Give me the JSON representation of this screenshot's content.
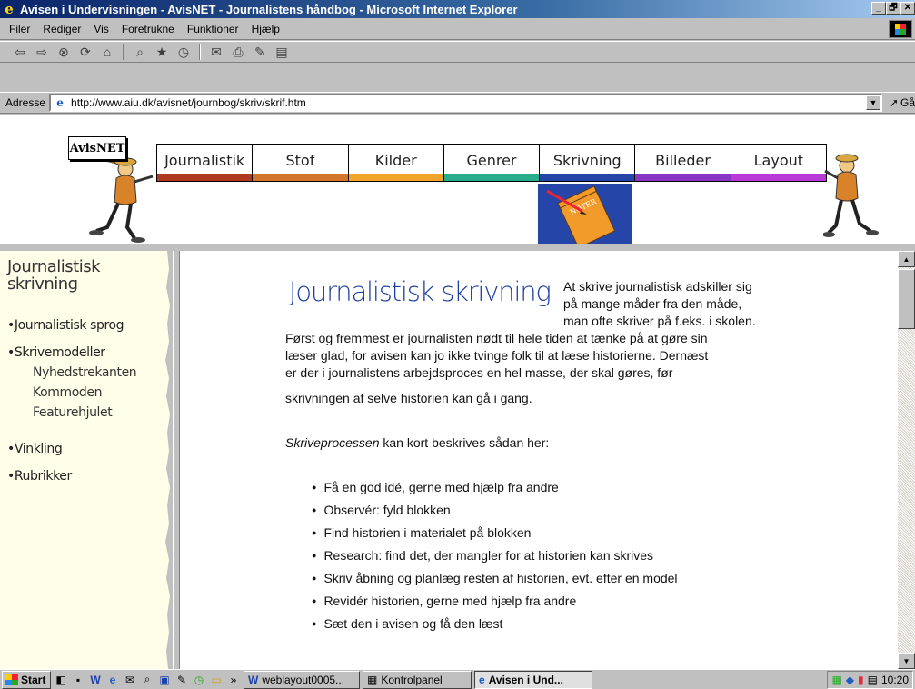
{
  "window": {
    "title": "Avisen i Undervisningen - AvisNET - Journalistens håndbog - Microsoft Internet Explorer",
    "controls": [
      "_",
      "🗗",
      "✕"
    ]
  },
  "menubar": {
    "items": [
      "Filer",
      "Rediger",
      "Vis",
      "Foretrukne",
      "Funktioner",
      "Hjælp"
    ]
  },
  "toolbar": {
    "icons": [
      "back-icon",
      "forward-icon",
      "stop-icon",
      "refresh-icon",
      "home-icon",
      "search-icon",
      "favorites-icon",
      "history-icon",
      "mail-icon",
      "print-icon",
      "edit-icon",
      "discuss-icon"
    ]
  },
  "address": {
    "label": "Adresse",
    "url": "http://www.aiu.dk/avisnet/journbog/skriv/skrif.htm",
    "go_label": "Gå"
  },
  "banner": {
    "sign": "AvisNET",
    "tabs": [
      {
        "label": "Journalistik",
        "color": "#b03a1f"
      },
      {
        "label": "Stof",
        "color": "#d2762a"
      },
      {
        "label": "Kilder",
        "color": "#f2a42b"
      },
      {
        "label": "Genrer",
        "color": "#27ad8c"
      },
      {
        "label": "Skrivning",
        "color": "#2546a8"
      },
      {
        "label": "Billeder",
        "color": "#8a36c4"
      },
      {
        "label": "Layout",
        "color": "#b83ad6"
      }
    ],
    "notebook_label": "NOTER"
  },
  "sidebar": {
    "title_line1": "Journalistisk",
    "title_line2": "skrivning",
    "items": [
      "•Journalistisk sprog",
      "•Skrivemodeller",
      "Nyhedstrekanten",
      "Kommoden",
      "Featurehjulet",
      "•Vinkling",
      "•Rubrikker"
    ]
  },
  "content": {
    "heading": "Journalistisk skrivning",
    "intro_line1": "At skrive journalistisk adskiller sig",
    "intro_line2": "på mange måder fra den måde,",
    "intro_line3": "man ofte skriver på f.eks. i skolen.",
    "para_line1": "Først og fremmest er journalisten nødt til hele tiden at tænke på at gøre sin",
    "para_line2": "læser glad, for avisen kan jo ikke tvinge folk til at læse historierne. Dernæst",
    "para_line3": "er der i journalistens arbejdsproces en hel masse, der skal gøres, før",
    "para_line4": "skrivningen af selve historien kan gå i gang.",
    "process_em": "Skriveprocessen",
    "process_rest": " kan kort beskrives sådan her:",
    "steps": [
      "Få en god idé, gerne med hjælp fra andre",
      "Observér: fyld blokken",
      "Find historien i materialet på blokken",
      "Research: find det, der mangler for at historien kan skrives",
      "Skriv åbning og planlæg resten af historien, evt. efter en model",
      "Revidér historien, gerne med hjælp fra andre",
      "Sæt den i avisen og få den læst"
    ]
  },
  "taskbar": {
    "start": "Start",
    "overflow": "»",
    "tasks": [
      "weblayout0005...",
      "Kontrolpanel",
      "Avisen i Und..."
    ],
    "clock": "10:20"
  }
}
